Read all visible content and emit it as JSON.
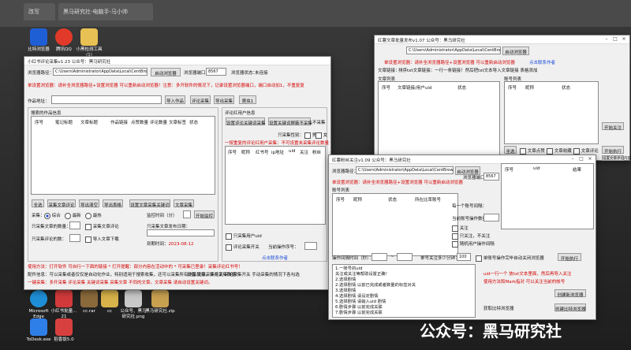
{
  "desktop": {
    "tabs": [
      "改写",
      "黑马研究社-电脑手-马小帅"
    ],
    "icons_top": [
      {
        "label": "比特浏览器",
        "color": "#1f5fd6"
      },
      {
        "label": "腾讯QQ",
        "color": "#e23a2a"
      },
      {
        "label": "小黑检测工具 (1)",
        "color": "#e8c154"
      }
    ],
    "icons_bottom": [
      {
        "label": "Microsoft Edge",
        "color": "#1e8fd6"
      },
      {
        "label": "小红书批量... 21",
        "color": "#d23a3a"
      },
      {
        "label": "cc.rar",
        "color": "#8a6a3a"
      },
      {
        "label": "cc",
        "color": "#d8b24a"
      },
      {
        "label": "公众号、黑马研究社.png",
        "color": "#c8c8c8"
      },
      {
        "label": "黑马研究社.zip",
        "color": "#c8a050"
      },
      {
        "label": "ToDesk.exe",
        "color": "#2f7fe8"
      },
      {
        "label": "稻香饭5.0",
        "color": "#d84040"
      }
    ],
    "watermark": "公众号：黑马研究社"
  },
  "main_window": {
    "title": "小红书评论采集v1.23 公众号：黑马研究社",
    "browser_path_label": "浏览器路径：",
    "browser_path": "C:\\Users\\Administrator\\AppData\\Local\\CentBrowser\\Ap",
    "launch_browser": "启动浏览器",
    "port_label": "浏览器端口：",
    "port": "8567",
    "status_label": "浏览器状态：",
    "status": "未连接",
    "notice": "单设置浏览器：请补全浏览器路径+设置浏览器 可以重新启动浏览器！注意：多开软件的情况下，记录设置浏览器端口，端口自动加1，不重复复",
    "search_label": "作品地址：",
    "search_value": "",
    "btn_import": "导入作品",
    "btn_collect": "评论采集",
    "btn_export_collect": "导出采集",
    "btn_retweet": "爬虫1",
    "left_group": "搜索的作品信息",
    "left_cols": [
      "序号",
      "笔记标题",
      "文章标题",
      "作品链接",
      "点赞数量",
      "评论数量",
      "文章标签",
      "状态"
    ],
    "btn_all": "全选",
    "btn_clear": "采集文章评论",
    "btn_open": "导出清空",
    "btn_export": "导出表格",
    "btn_setting": "设置文章采集关键词",
    "btn_article": "文章采集",
    "collect_label": "采集：",
    "radios": [
      "综合",
      "最新",
      "最热"
    ],
    "interval_label": "监控时间（分）",
    "btn_start_monitor": "开始监控",
    "collect_article_count": "只采集文章的数量：",
    "collect_comment_label": "采集文章评论",
    "comment_collect_label": "只采集评论的数：",
    "import_label": "导入文章下载",
    "collect_time_label": "只采集文章发布日期：",
    "expire_label": "到期时间：",
    "expire": "2023-08-12",
    "right_group": "评论红用户信息",
    "btn_set_keyword": "设置评论关键词采集",
    "btn_set_block": "设置关键词屏蔽不采集",
    "not_collect": "不采集",
    "collect_gender": "只采集性别：",
    "genders": [
      "男",
      "女"
    ],
    "user_note": "一按重复的评论红用户采集：不可设置未采集评论数量",
    "right_cols": [
      "序号",
      "昵称",
      "红书号",
      "ip地址",
      "uid",
      "关注",
      "粉丝",
      "获赞与收藏"
    ],
    "only_uid": "只采集用户uid",
    "comment_collect": "评论采集开关",
    "current_task": "当前操作序号：",
    "contact": "点击联系作者",
    "footer1": "使用方法：打开软件 可自行一下面的链接 * 打开提醒：部分内容在活动中的 * 可采集已登录！采集评论红书号！",
    "footer2": "配件信息：可以采集或者仅仅是自动化作业，特别适用于搜索收集，还可以采集所有作品链接，评论采集数据！",
    "footer3": "一键采集：多开采集 评论采集 关键词采集 采集文章 不同的文章。文章采集 请自动设置关键词。",
    "footer_side": "设置 文章采集开关 评论采集开关 手动采集的情况下各勾选"
  },
  "top_right_window": {
    "title": "红薯文章批量发布v1.07 公众号：黑马研究社",
    "browser_path": "C:\\Users\\Administrator\\AppData\\Local\\CentBrowser\\Ap",
    "launch_browser": "启动浏览器",
    "notice": "单设置浏览器：请补全浏览器路径+设置浏览器 可以重新启动浏览器",
    "contact": "点击联系作者",
    "import_label": "文章链接：",
    "import_hint": "排序txt文章链接：一行一条链接！然后把txt文本导入文章链接 表格添加",
    "article_list_label": "文章列表",
    "cols": [
      "序号",
      "文章链接/用户uid",
      "状态"
    ],
    "right_list_label": "账号列表",
    "right_cols": [
      "序号",
      "昵称",
      "状态"
    ],
    "btn_start": "开始关注",
    "btn_all": "全选",
    "chk1": "文章点赞",
    "chk2": "文章收藏",
    "chk3": "文章评论",
    "btn_exec": "开始执行",
    "btn_reset": "设置文章评论内容"
  },
  "front_window": {
    "title": "红薯粉丝关注v1.09 公众号：黑马研究社",
    "browser_path_label": "浏览器路径：",
    "browser_path": "C:\\Users\\Administrator\\AppData\\Local\\CentBrowser\\Ap",
    "launch_browser": "启动浏览器",
    "port_label": "浏览器端口：",
    "port": "8567",
    "notice": "单设置浏览器：请补全浏览器路径+设置浏览器 可以重新启动浏览器",
    "account_label": "账号列表",
    "cols": [
      "序号",
      "昵称",
      "状态",
      "所在比率账号"
    ],
    "uid_cols": [
      "序号",
      "uid",
      "结果"
    ],
    "group_label": "操作间隔",
    "current_account_label": "当前账号操作数量：",
    "every_interval_label": "每一个账号间隔：",
    "chk_all_close": "关注",
    "chk_not_follow": "只关注，不关注",
    "chk_private": "随机用户操作间隔",
    "interval_label": "操作间隔时间（秒）：",
    "interval_min": "",
    "interval_max": "",
    "per_follow_label": "单号关注多少分钟：",
    "per_follow_value": "100",
    "chk_finish_close": "单账号操作完毕自动关闭浏览器",
    "btn_exec": "开始执行",
    "log_lines": [
      "1.一账号的uid",
      "关注或关注等帮助设置正确！",
      "2.选择剧情",
      "2.选择剧情 以前已完成或者数量的标签对关",
      "3.选择剧情",
      "4.选择剧情 请设定剧情",
      "5.选择剧情 请输入uid 剧情",
      "6.剧情步骤 以前完成关联",
      "7.剧情步骤 以前完成关联",
      "8.剧情步骤关联"
    ],
    "red_note_1": "uid一行一个 放txt文本里面，然后再导入关注",
    "red_note_2": "使用方法和Mark指对 可以关注当前的帐号",
    "btn_get_ids": "获取链接浏览器",
    "btn_start_browser": "创建新浏览器",
    "btn_reload": "创建比特浏览器",
    "bit_label": "获取比特浏览器",
    "footer_label": "获取比特浏览器"
  }
}
